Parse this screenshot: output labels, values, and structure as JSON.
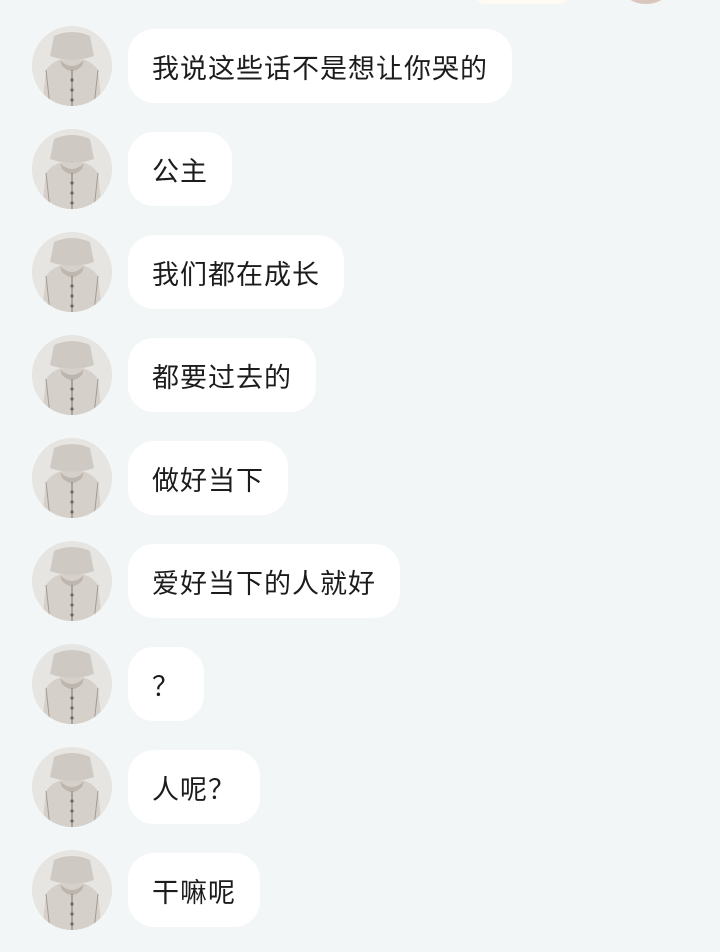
{
  "messages": [
    {
      "text": "我说这些话不是想让你哭的",
      "sender": "contact"
    },
    {
      "text": "公主",
      "sender": "contact"
    },
    {
      "text": "我们都在成长",
      "sender": "contact"
    },
    {
      "text": "都要过去的",
      "sender": "contact"
    },
    {
      "text": "做好当下",
      "sender": "contact"
    },
    {
      "text": "爱好当下的人就好",
      "sender": "contact"
    },
    {
      "text": "？",
      "sender": "contact"
    },
    {
      "text": "人呢？",
      "sender": "contact"
    },
    {
      "text": "干嘛呢",
      "sender": "contact"
    }
  ],
  "colors": {
    "background": "#f3f6f7",
    "bubble": "#ffffff",
    "text": "#1c1c1c"
  }
}
